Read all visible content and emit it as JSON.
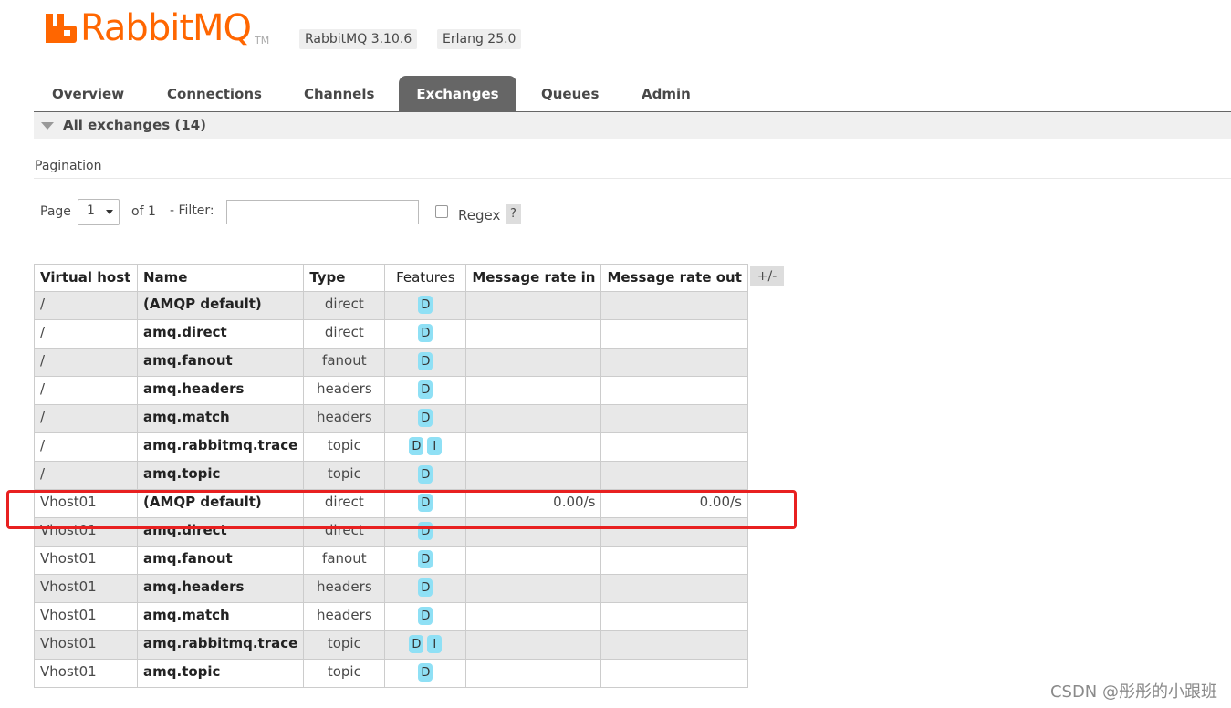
{
  "brand": {
    "name": "RabbitMQ",
    "tm": "TM",
    "color": "#ff6600"
  },
  "versions": {
    "rabbitmq": "RabbitMQ 3.10.6",
    "erlang": "Erlang 25.0"
  },
  "tabs": [
    {
      "label": "Overview",
      "active": false
    },
    {
      "label": "Connections",
      "active": false
    },
    {
      "label": "Channels",
      "active": false
    },
    {
      "label": "Exchanges",
      "active": true
    },
    {
      "label": "Queues",
      "active": false
    },
    {
      "label": "Admin",
      "active": false
    }
  ],
  "section": {
    "title": "All exchanges (14)",
    "icon": "collapse-triangle-icon"
  },
  "pagination": {
    "label": "Pagination",
    "page_label": "Page",
    "page_value": "1",
    "of_label": "of 1",
    "filter_label": "- Filter:",
    "filter_value": "",
    "regex_label": "Regex",
    "help_label": "?"
  },
  "table": {
    "columns": [
      "Virtual host",
      "Name",
      "Type",
      "Features",
      "Message rate in",
      "Message rate out"
    ],
    "toggle_label": "+/-",
    "rows": [
      {
        "vhost": "/",
        "name": "(AMQP default)",
        "type": "direct",
        "features": [
          "D"
        ],
        "rate_in": "",
        "rate_out": ""
      },
      {
        "vhost": "/",
        "name": "amq.direct",
        "type": "direct",
        "features": [
          "D"
        ],
        "rate_in": "",
        "rate_out": ""
      },
      {
        "vhost": "/",
        "name": "amq.fanout",
        "type": "fanout",
        "features": [
          "D"
        ],
        "rate_in": "",
        "rate_out": ""
      },
      {
        "vhost": "/",
        "name": "amq.headers",
        "type": "headers",
        "features": [
          "D"
        ],
        "rate_in": "",
        "rate_out": ""
      },
      {
        "vhost": "/",
        "name": "amq.match",
        "type": "headers",
        "features": [
          "D"
        ],
        "rate_in": "",
        "rate_out": ""
      },
      {
        "vhost": "/",
        "name": "amq.rabbitmq.trace",
        "type": "topic",
        "features": [
          "D",
          "I"
        ],
        "rate_in": "",
        "rate_out": ""
      },
      {
        "vhost": "/",
        "name": "amq.topic",
        "type": "topic",
        "features": [
          "D"
        ],
        "rate_in": "",
        "rate_out": ""
      },
      {
        "vhost": "Vhost01",
        "name": "(AMQP default)",
        "type": "direct",
        "features": [
          "D"
        ],
        "rate_in": "0.00/s",
        "rate_out": "0.00/s"
      },
      {
        "vhost": "Vhost01",
        "name": "amq.direct",
        "type": "direct",
        "features": [
          "D"
        ],
        "rate_in": "",
        "rate_out": ""
      },
      {
        "vhost": "Vhost01",
        "name": "amq.fanout",
        "type": "fanout",
        "features": [
          "D"
        ],
        "rate_in": "",
        "rate_out": ""
      },
      {
        "vhost": "Vhost01",
        "name": "amq.headers",
        "type": "headers",
        "features": [
          "D"
        ],
        "rate_in": "",
        "rate_out": ""
      },
      {
        "vhost": "Vhost01",
        "name": "amq.match",
        "type": "headers",
        "features": [
          "D"
        ],
        "rate_in": "",
        "rate_out": ""
      },
      {
        "vhost": "Vhost01",
        "name": "amq.rabbitmq.trace",
        "type": "topic",
        "features": [
          "D",
          "I"
        ],
        "rate_in": "",
        "rate_out": ""
      },
      {
        "vhost": "Vhost01",
        "name": "amq.topic",
        "type": "topic",
        "features": [
          "D"
        ],
        "rate_in": "",
        "rate_out": ""
      }
    ]
  },
  "annotation": {
    "highlight_color": "#e82020"
  },
  "watermark": "CSDN @彤彤的小跟班"
}
